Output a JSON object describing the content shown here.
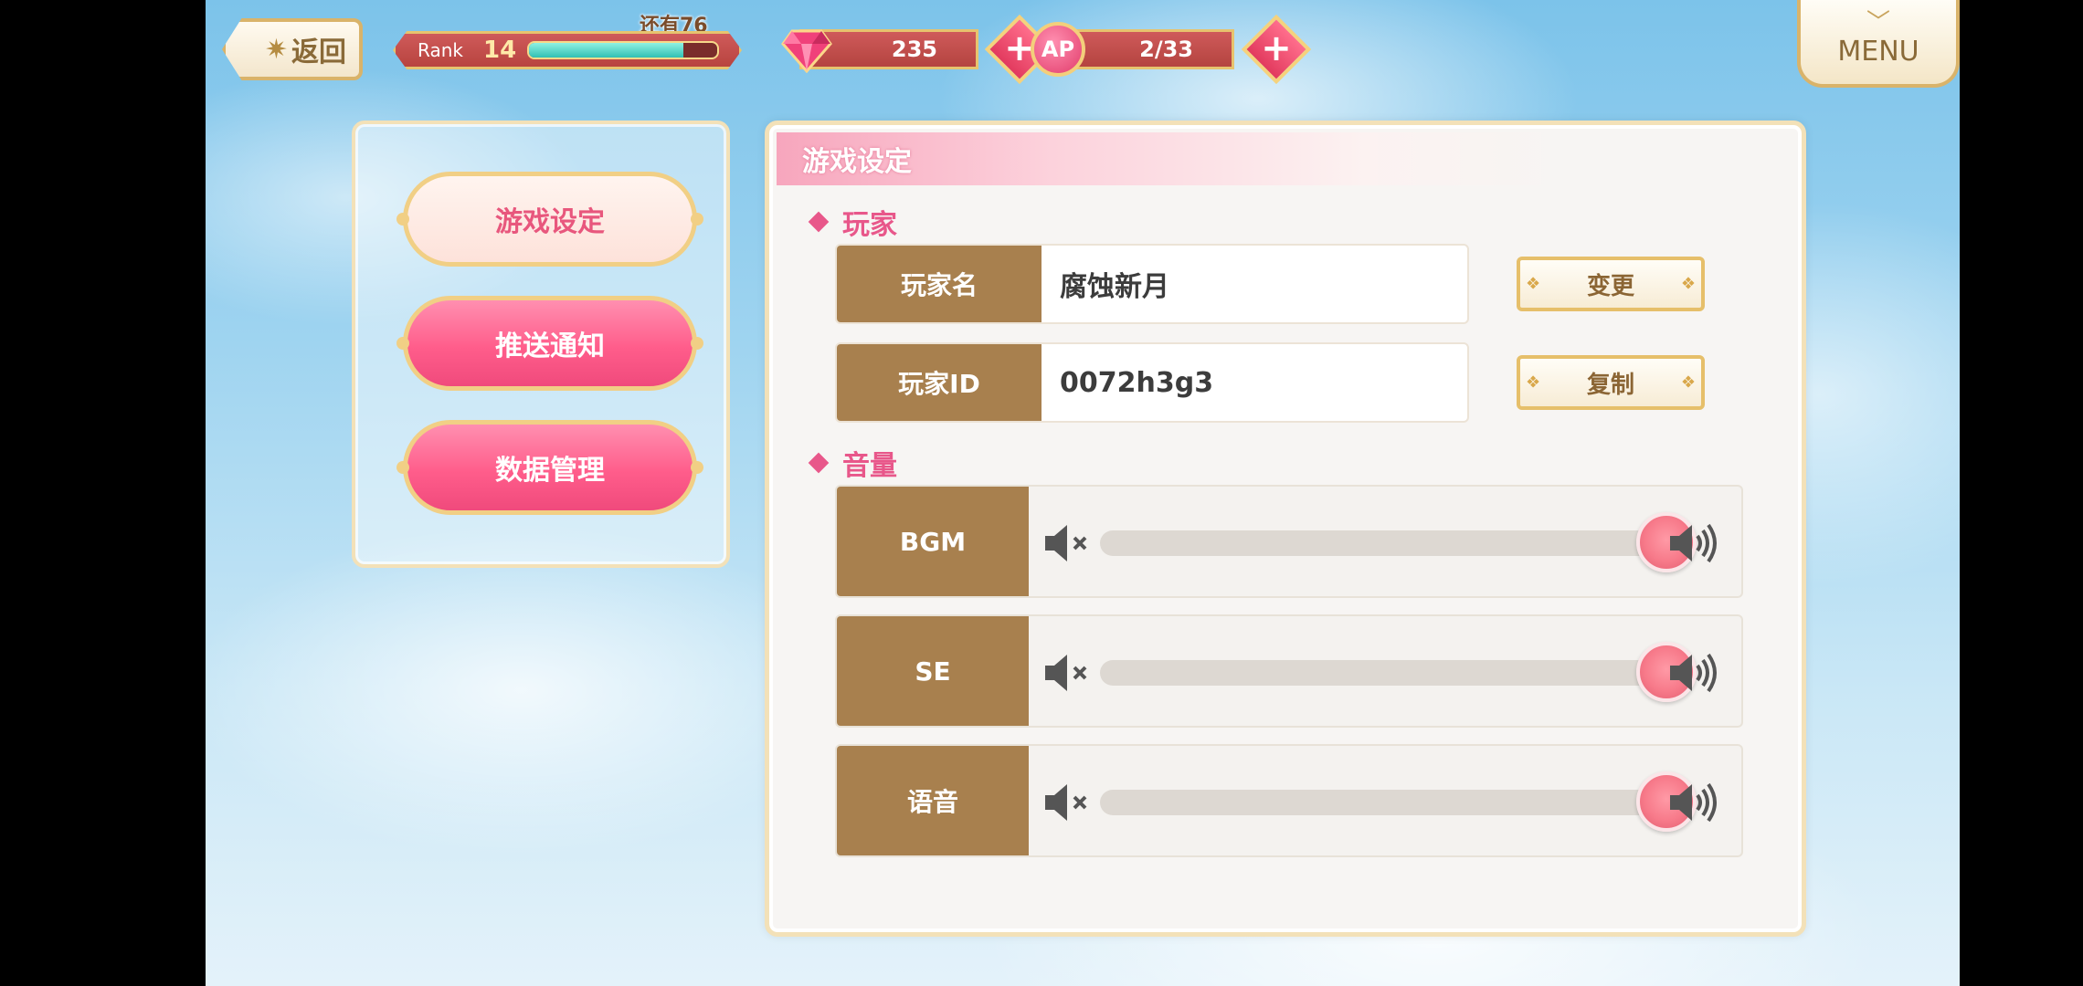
{
  "topbar": {
    "back_label": "返回",
    "rank_label": "Rank",
    "rank_value": "14",
    "rank_remaining": "还有76",
    "rank_progress": 0.82,
    "gems": "235",
    "ap_icon_label": "AP",
    "ap": "2/33",
    "menu_label": "MENU",
    "plus_label": "+"
  },
  "sidebar": {
    "items": [
      {
        "label": "游戏设定",
        "active": true
      },
      {
        "label": "推送通知",
        "active": false
      },
      {
        "label": "数据管理",
        "active": false
      }
    ]
  },
  "main": {
    "title": "游戏设定",
    "player_section": "玩家",
    "player_name_label": "玩家名",
    "player_name": "腐蚀新月",
    "change_button": "变更",
    "player_id_label": "玩家ID",
    "player_id": "0072h3g3",
    "copy_button": "复制",
    "volume_section": "音量",
    "volume": [
      {
        "label": "BGM",
        "level": 1.0
      },
      {
        "label": "SE",
        "level": 1.0
      },
      {
        "label": "语音",
        "level": 1.0
      }
    ]
  },
  "colors": {
    "accent_pink": "#e8578a",
    "label_brown": "#a8804e",
    "gold_border": "#e6bf6a"
  }
}
